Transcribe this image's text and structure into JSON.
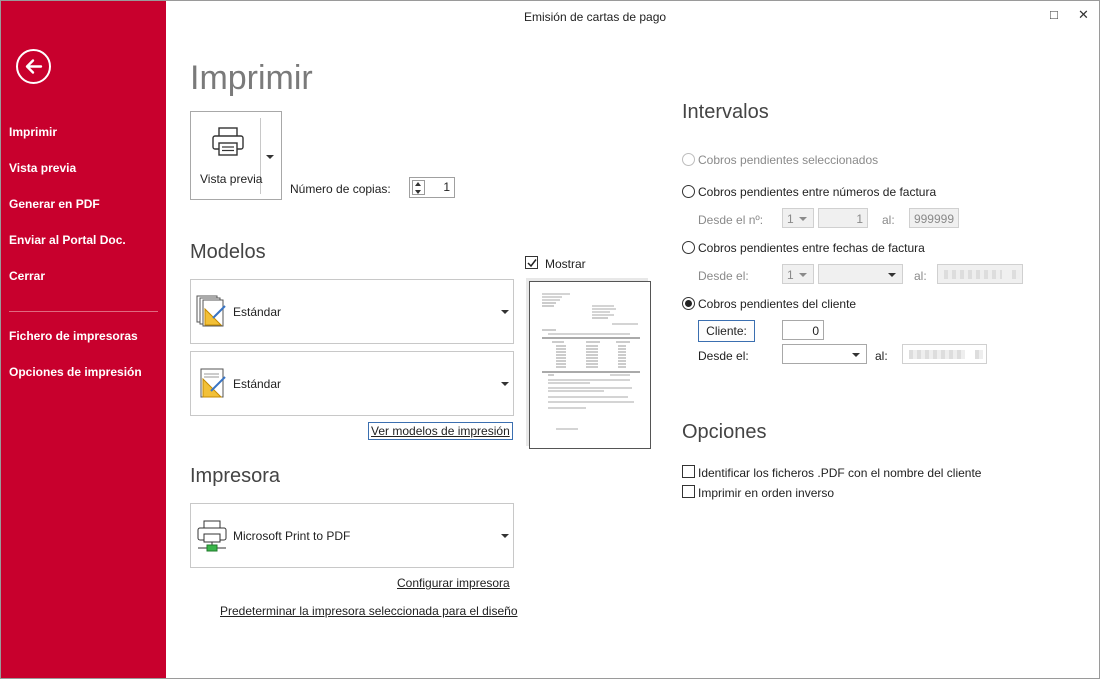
{
  "window": {
    "title": "Emisión de cartas de pago",
    "maximize_glyph": "□",
    "close_glyph": "✕"
  },
  "sidebar": {
    "items": [
      {
        "label": "Imprimir"
      },
      {
        "label": "Vista previa"
      },
      {
        "label": "Generar en PDF"
      },
      {
        "label": "Enviar al Portal Doc."
      },
      {
        "label": "Cerrar"
      },
      {
        "label": "Fichero de impresoras"
      },
      {
        "label": "Opciones de impresión"
      }
    ]
  },
  "main": {
    "title": "Imprimir",
    "preview_button": {
      "label": "Vista previa",
      "icon": "printer-icon"
    },
    "copies": {
      "label": "Número de copias:",
      "value": "1"
    },
    "models": {
      "title": "Modelos",
      "show_label": "Mostrar",
      "show_checked": true,
      "combo1": {
        "value": "Estándar"
      },
      "combo2": {
        "value": "Estándar"
      },
      "view_models_link": "Ver modelos de impresión"
    },
    "printer": {
      "title": "Impresora",
      "combo": {
        "value": "Microsoft Print to PDF"
      },
      "configure_link": "Configurar impresora",
      "default_link": "Predeterminar la impresora seleccionada para el diseño"
    }
  },
  "intervals": {
    "title": "Intervalos",
    "opt_selected": "Cobros pendientes seleccionados",
    "opt_invoice_numbers": "Cobros pendientes entre números de factura",
    "from_no_label": "Desde el nº:",
    "from_no_series": "1",
    "from_no_value": "1",
    "to_label": "al:",
    "to_no_value": "999999",
    "opt_invoice_dates": "Cobros pendientes entre fechas de factura",
    "from_label": "Desde el:",
    "from_date_series": "1",
    "to_date_label": "al:",
    "opt_client": "Cobros pendientes del cliente",
    "client_button": "Cliente:",
    "client_value": "0",
    "client_from_label": "Desde el:",
    "client_to_label": "al:"
  },
  "options": {
    "title": "Opciones",
    "opt1": "Identificar los ficheros .PDF con el nombre del cliente",
    "opt2": "Imprimir en orden inverso"
  },
  "colors": {
    "accent": "#c8002d",
    "link_border": "#3b6fb0"
  }
}
